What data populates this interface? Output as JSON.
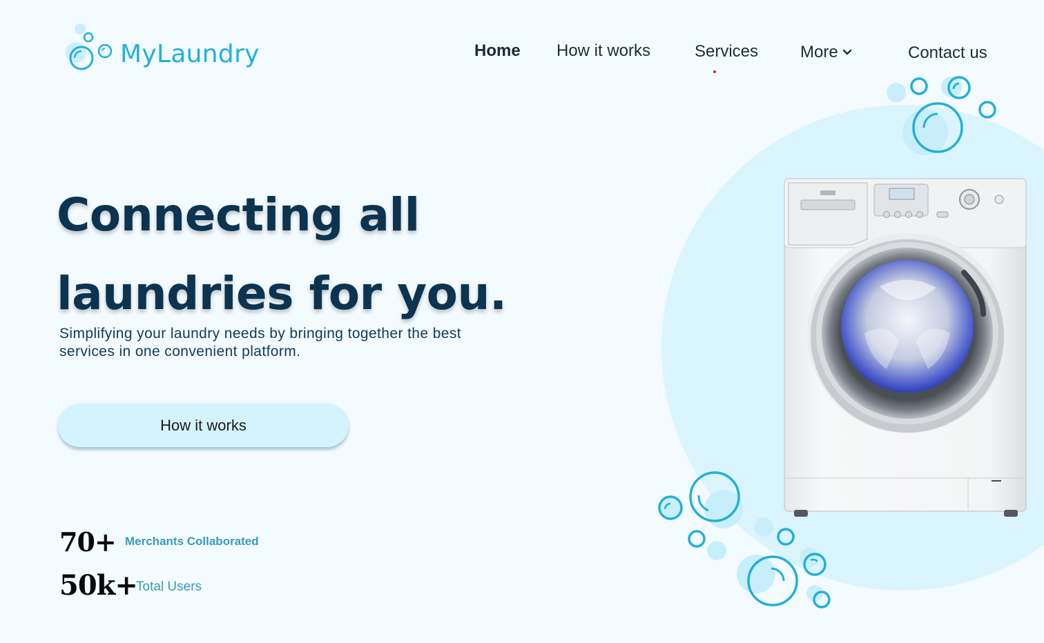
{
  "logo": {
    "text": "MyLaundry",
    "icon": "bubbles-logo-icon"
  },
  "nav": {
    "home": "Home",
    "how_it_works": "How it works",
    "services": "Services",
    "more": "More",
    "contact": "Contact us",
    "active": "Services"
  },
  "hero": {
    "title_line1": "Connecting all",
    "title_line2": "laundries for you.",
    "subtitle": "Simplifying your laundry needs by bringing together the best services in one convenient platform.",
    "cta": "How it works"
  },
  "stats": [
    {
      "value": "70+",
      "label": "Merchants Collaborated"
    },
    {
      "value": "50k+",
      "label": "Total Users"
    }
  ],
  "colors": {
    "accent": "#22b0d6",
    "background": "#f3fbff",
    "title": "#0c3450",
    "cta_bg": "#d4f4fd"
  }
}
